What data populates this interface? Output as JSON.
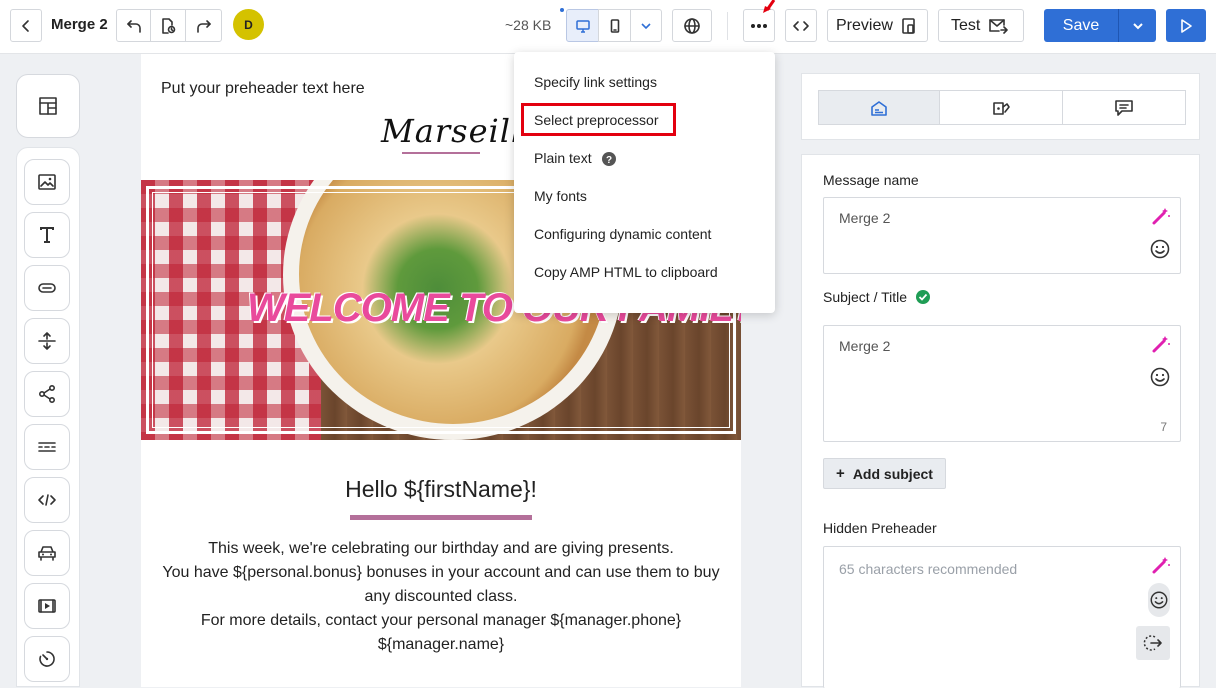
{
  "header": {
    "title": "Merge 2",
    "avatar_letter": "D",
    "size": "~28 KB",
    "preview_label": "Preview",
    "test_label": "Test",
    "save_label": "Save"
  },
  "menu": {
    "items": [
      "Specify link settings",
      "Select preprocessor",
      "Plain text",
      "My fonts",
      "Configuring dynamic content",
      "Copy AMP HTML to clipboard"
    ],
    "highlighted_index": 1
  },
  "email": {
    "preheader": "Put your preheader text here",
    "logo": "Marseille",
    "banner_text": "WELCOME TO OUR FAMILY",
    "greeting": "Hello ${firstName}!",
    "body_lines": [
      "This week, we're celebrating our birthday and are giving presents.",
      "You have ${personal.bonus} bonuses in your account and can use them to buy",
      "any discounted class.",
      "For more details, contact your personal manager ${manager.phone}",
      "${manager.name}"
    ]
  },
  "settings": {
    "message_name_label": "Message name",
    "message_name_value": "Merge 2",
    "subject_label": "Subject / Title",
    "subject_value": "Merge 2",
    "subject_count": "7",
    "add_subject_label": "Add subject",
    "preheader_label": "Hidden Preheader",
    "preheader_placeholder": "65 characters recommended"
  },
  "colors": {
    "accent": "#2f6fd6",
    "menu_highlight": "#e3000f",
    "logo_underline": "#b4709a",
    "avatar": "#d4c200",
    "magic": "#e020b0",
    "banner_text": "#e94a9c"
  }
}
